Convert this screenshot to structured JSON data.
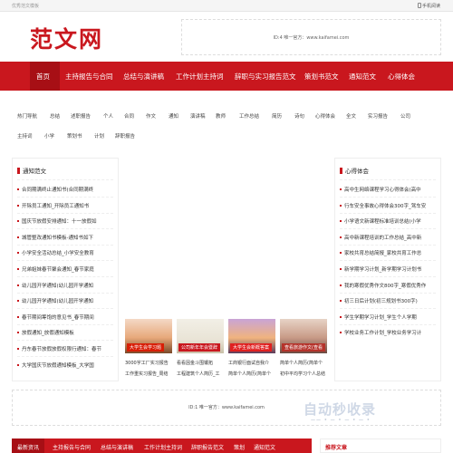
{
  "topbar": {
    "crumb": "优秀范文模板",
    "mobile": "手机阅读"
  },
  "logo": {
    "text": "范文网"
  },
  "ad_top": {
    "text": "ID:4 唯一官方：www.kaifamei.com"
  },
  "nav": {
    "items": [
      "首页",
      "主持报告与合同",
      "总结与演讲稿",
      "工作计划主持词",
      "辞职与实习报告范文",
      "策划书范文",
      "通知范文",
      "心得体会"
    ]
  },
  "tags": {
    "row1": [
      "热门导航",
      "总结",
      "述职报告",
      "个人",
      "合同",
      "作文",
      "通知",
      "演讲稿",
      "教师",
      "工作总结",
      "简历",
      "诗句",
      "心得体会",
      "全文",
      "实习报告",
      "公司"
    ],
    "row2": [
      "主持词",
      "小学",
      "策划书",
      "计划",
      "辞职报告"
    ]
  },
  "left_box": {
    "title": "通知范文",
    "items": [
      "合同期满终止通知书(合同期满终",
      "开除员工通知_开除员工通知书",
      "国庆节放假安排通知：十一放假如",
      "城管整改通知书模板-通知书如下",
      "小学安全活动总结_小学安全教育",
      "兄弟姐妹春节聚会通知_春节家庭",
      "幼儿园开学通知(幼儿园开学通知",
      "幼儿园开学通知(幼儿园开学通知",
      "春节期间筹饱的意见书_春节期间",
      "放假通知_放假通知模板",
      "丹东春节放假放假权限行通知：春节",
      "大学国庆节放假通知模板_大学国"
    ]
  },
  "right_box": {
    "title": "心得体会",
    "items": [
      "高中生网络课程学习心得体会(高中",
      "行车安全事故心得体会300字_驾车安",
      "小学语文新课程标准培训总结(小学",
      "高中新课程培训的工作总结_高中新",
      "家校共育总结简报_家校共育工作总",
      "新学期学习计划_新学期学习计划书",
      "我的寒假优秀作文800字_寒假优秀作",
      "初三日后计划(初三规划书300字)",
      "学生学期学习计划_学生个人学期",
      "学校业务工作计划_学校业务学习计"
    ]
  },
  "cards": [
    {
      "label": "大学生会学习题",
      "lines": [
        "3000字工厂实习报告",
        "工作重实习报告_周结"
      ]
    },
    {
      "label": "公司新年年会暨辞",
      "lines": [
        "看看因金斗围镶拓",
        "工程建筑个人简历_工"
      ]
    },
    {
      "label": "大学生会新概答案",
      "lines": [
        "工商银行面试自我介",
        "简单个人简历(简单个"
      ]
    },
    {
      "label": "查看旅游作文(查看",
      "lines": [
        "简单个人简历(简单个",
        "初中平均学习个人总结"
      ]
    }
  ],
  "ad_bottom": {
    "text": "ID:1 唯一官方：www.kaifamei.com"
  },
  "watermark": {
    "text": "自动秒收录",
    "sub": "—— • — • — • — •"
  },
  "nav2": {
    "items": [
      "最新资讯",
      "主持报告与合同",
      "总结与演讲稿",
      "工作计划主持词",
      "辞职报告范文",
      "策划",
      "通知范文"
    ]
  },
  "recommend": {
    "title": "推荐文章"
  },
  "colors": {
    "brand_red": "#c9171e",
    "dark_red": "#a70f15"
  }
}
